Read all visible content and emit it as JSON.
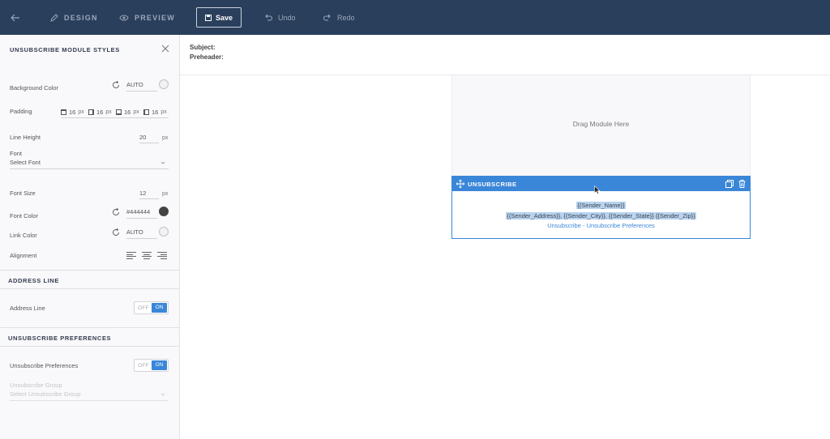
{
  "toolbar": {
    "design_label": "DESIGN",
    "preview_label": "PREVIEW",
    "save_label": "Save",
    "undo_label": "Undo",
    "redo_label": "Redo"
  },
  "panel": {
    "title": "UNSUBSCRIBE MODULE STYLES",
    "background_color": {
      "label": "Background Color",
      "value": "AUTO"
    },
    "padding": {
      "label": "Padding",
      "top": "16",
      "right": "16",
      "bottom": "16",
      "left": "16",
      "unit": "px"
    },
    "line_height": {
      "label": "Line Height",
      "value": "20",
      "unit": "px"
    },
    "font": {
      "label": "Font",
      "placeholder": "Select Font"
    },
    "font_size": {
      "label": "Font Size",
      "value": "12",
      "unit": "px"
    },
    "font_color": {
      "label": "Font Color",
      "value": "#444444",
      "swatch": "#444444"
    },
    "link_color": {
      "label": "Link Color",
      "value": "AUTO"
    },
    "alignment": {
      "label": "Alignment"
    },
    "address_section": {
      "title": "ADDRESS LINE",
      "label": "Address Line",
      "off": "OFF",
      "on": "ON"
    },
    "unsub_section": {
      "title": "UNSUBSCRIBE PREFERENCES",
      "label": "Unsubscribe Preferences",
      "off": "OFF",
      "on": "ON",
      "group_label": "Unsubscribe Group",
      "group_placeholder": "Select Unsubscribe Group"
    }
  },
  "header": {
    "subject_label": "Subject:",
    "preheader_label": "Preheader:"
  },
  "canvas": {
    "drag_text": "Drag Module Here",
    "module_title": "UNSUBSCRIBE",
    "sender_name": "{{Sender_Name}}",
    "sender_address": "{{Sender_Address}}, {{Sender_City}}, {{Sender_State}} {{Sender_Zip}}",
    "unsubscribe_link": "Unsubscribe",
    "separator": "-",
    "preferences_link": "Unsubscribe Preferences"
  },
  "colors": {
    "topbar": "#2a3f5c",
    "accent": "#3a86d8"
  }
}
